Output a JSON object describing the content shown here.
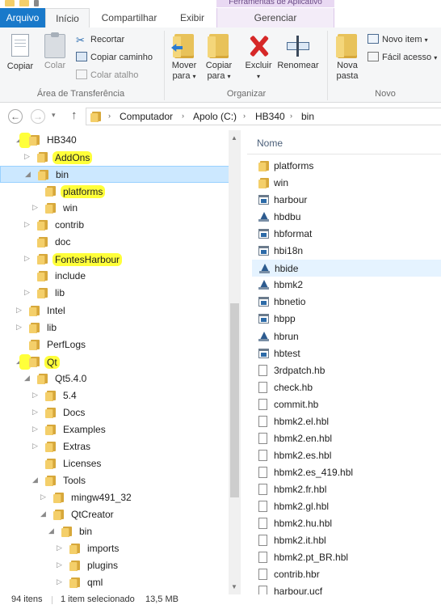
{
  "window": {
    "context_header": "Ferramentas de Aplicativo"
  },
  "tabs": {
    "arquivo": "Arquivo",
    "inicio": "Início",
    "compartilhar": "Compartilhar",
    "exibir": "Exibir",
    "gerenciar": "Gerenciar"
  },
  "ribbon": {
    "copiar": "Copiar",
    "colar": "Colar",
    "recortar": "Recortar",
    "copiar_caminho": "Copiar caminho",
    "colar_atalho": "Colar atalho",
    "group_transferencia": "Área de Transferência",
    "mover_para_1": "Mover",
    "mover_para_2": "para",
    "copiar_para_1": "Copiar",
    "copiar_para_2": "para",
    "excluir": "Excluir",
    "renomear": "Renomear",
    "group_organizar": "Organizar",
    "nova_pasta_1": "Nova",
    "nova_pasta_2": "pasta",
    "novo_item": "Novo item",
    "facil_acesso": "Fácil acesso",
    "group_novo": "Novo"
  },
  "address": {
    "crumbs": [
      "Computador",
      "Apolo (C:)",
      "HB340",
      "bin"
    ]
  },
  "tree": [
    {
      "label": "HB340",
      "level": 0,
      "expanded": true
    },
    {
      "label": "AddOns",
      "level": 1,
      "expanded": false
    },
    {
      "label": "bin",
      "level": 1,
      "expanded": true,
      "selected": true
    },
    {
      "label": "platforms",
      "level": 2,
      "expanded": null
    },
    {
      "label": "win",
      "level": 2,
      "expanded": false
    },
    {
      "label": "contrib",
      "level": 1,
      "expanded": false
    },
    {
      "label": "doc",
      "level": 1,
      "expanded": null
    },
    {
      "label": "FontesHarbour",
      "level": 1,
      "expanded": false
    },
    {
      "label": "include",
      "level": 1,
      "expanded": null
    },
    {
      "label": "lib",
      "level": 1,
      "expanded": false
    },
    {
      "label": "Intel",
      "level": 0,
      "expanded": false
    },
    {
      "label": "lib",
      "level": 0,
      "expanded": false
    },
    {
      "label": "PerfLogs",
      "level": 0,
      "expanded": null
    },
    {
      "label": "Qt",
      "level": 0,
      "expanded": true
    },
    {
      "label": "Qt5.4.0",
      "level": 1,
      "expanded": true
    },
    {
      "label": "5.4",
      "level": 2,
      "expanded": false
    },
    {
      "label": "Docs",
      "level": 2,
      "expanded": false
    },
    {
      "label": "Examples",
      "level": 2,
      "expanded": false
    },
    {
      "label": "Extras",
      "level": 2,
      "expanded": false
    },
    {
      "label": "Licenses",
      "level": 2,
      "expanded": null
    },
    {
      "label": "Tools",
      "level": 2,
      "expanded": true
    },
    {
      "label": "mingw491_32",
      "level": 3,
      "expanded": false
    },
    {
      "label": "QtCreator",
      "level": 3,
      "expanded": true
    },
    {
      "label": "bin",
      "level": 4,
      "expanded": true
    },
    {
      "label": "imports",
      "level": 5,
      "expanded": false
    },
    {
      "label": "plugins",
      "level": 5,
      "expanded": false
    },
    {
      "label": "qml",
      "level": 5,
      "expanded": false
    }
  ],
  "list": {
    "column_name": "Nome",
    "files": [
      {
        "name": "platforms",
        "icon": "folder"
      },
      {
        "name": "win",
        "icon": "folder"
      },
      {
        "name": "harbour",
        "icon": "exe"
      },
      {
        "name": "hbdbu",
        "icon": "qt-app"
      },
      {
        "name": "hbformat",
        "icon": "exe"
      },
      {
        "name": "hbi18n",
        "icon": "exe"
      },
      {
        "name": "hbide",
        "icon": "qt-app"
      },
      {
        "name": "hbmk2",
        "icon": "qt-app"
      },
      {
        "name": "hbnetio",
        "icon": "exe"
      },
      {
        "name": "hbpp",
        "icon": "exe"
      },
      {
        "name": "hbrun",
        "icon": "qt-app"
      },
      {
        "name": "hbtest",
        "icon": "exe"
      },
      {
        "name": "3rdpatch.hb",
        "icon": "doc"
      },
      {
        "name": "check.hb",
        "icon": "doc"
      },
      {
        "name": "commit.hb",
        "icon": "doc"
      },
      {
        "name": "hbmk2.el.hbl",
        "icon": "doc"
      },
      {
        "name": "hbmk2.en.hbl",
        "icon": "doc"
      },
      {
        "name": "hbmk2.es.hbl",
        "icon": "doc"
      },
      {
        "name": "hbmk2.es_419.hbl",
        "icon": "doc"
      },
      {
        "name": "hbmk2.fr.hbl",
        "icon": "doc"
      },
      {
        "name": "hbmk2.gl.hbl",
        "icon": "doc"
      },
      {
        "name": "hbmk2.hu.hbl",
        "icon": "doc"
      },
      {
        "name": "hbmk2.it.hbl",
        "icon": "doc"
      },
      {
        "name": "hbmk2.pt_BR.hbl",
        "icon": "doc"
      },
      {
        "name": "contrib.hbr",
        "icon": "doc"
      },
      {
        "name": "harbour.ucf",
        "icon": "doc"
      }
    ]
  },
  "status": {
    "items": "94 itens",
    "selected": "1 item selecionado",
    "size": "13,5 MB"
  },
  "colors": {
    "accent": "#1979ca",
    "highlight": "#ffff3a",
    "selection": "#cce8ff",
    "folder": "#f4cf6a"
  }
}
